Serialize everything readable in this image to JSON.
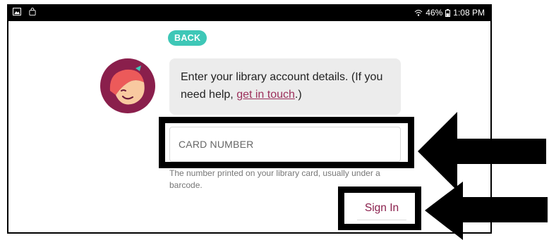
{
  "status_bar": {
    "battery": "46%",
    "time": "1:08 PM",
    "icons": [
      "image-icon",
      "shopping-bag-icon",
      "wifi-icon",
      "battery-icon"
    ]
  },
  "back_button": {
    "label": "BACK"
  },
  "message": {
    "text_before": "Enter your library account details. (If you need help, ",
    "link_text": "get in touch",
    "text_after": ".)"
  },
  "card_field": {
    "placeholder": "CARD NUMBER",
    "value": ""
  },
  "hint": "The number printed on your library card, usually under a barcode.",
  "sign_in": {
    "label": "Sign In"
  },
  "colors": {
    "back_button": "#3ec7b7",
    "link": "#9c2f5b",
    "sign_in": "#8a1f4c",
    "avatar_circle": "#8a1f4c",
    "bubble": "#ececec"
  },
  "annotations": [
    "arrow-pointing-to-card-number",
    "arrow-pointing-to-sign-in"
  ]
}
